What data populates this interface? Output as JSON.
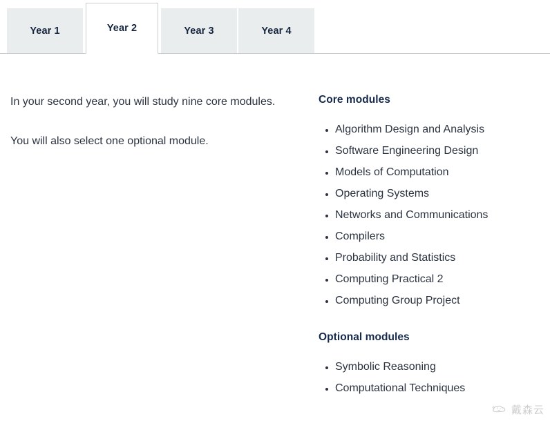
{
  "tabs": [
    {
      "label": "Year 1",
      "active": false
    },
    {
      "label": "Year 2",
      "active": true
    },
    {
      "label": "Year 3",
      "active": false
    },
    {
      "label": "Year 4",
      "active": false
    }
  ],
  "left_column": {
    "paragraph_1": "In your second year, you will study nine core modules.",
    "paragraph_2": "You will also select one optional module."
  },
  "right_column": {
    "core_heading": "Core modules",
    "core_modules": [
      "Algorithm Design and Analysis",
      "Software Engineering Design",
      "Models of Computation",
      "Operating Systems",
      "Networks and Communications",
      "Compilers",
      "Probability and Statistics",
      "Computing Practical 2",
      "Computing Group Project"
    ],
    "optional_heading": "Optional modules",
    "optional_modules": [
      "Symbolic Reasoning",
      "Computational Techniques"
    ]
  },
  "watermark": {
    "text": "戴森云",
    "icon": "cloud-face-logo-icon"
  },
  "colors": {
    "tab_inactive_bg": "#e9eded",
    "tab_active_bg": "#ffffff",
    "tab_text": "#15253f",
    "heading": "#16294a",
    "body_text": "#2b3340",
    "rule": "#c9cdd0"
  }
}
